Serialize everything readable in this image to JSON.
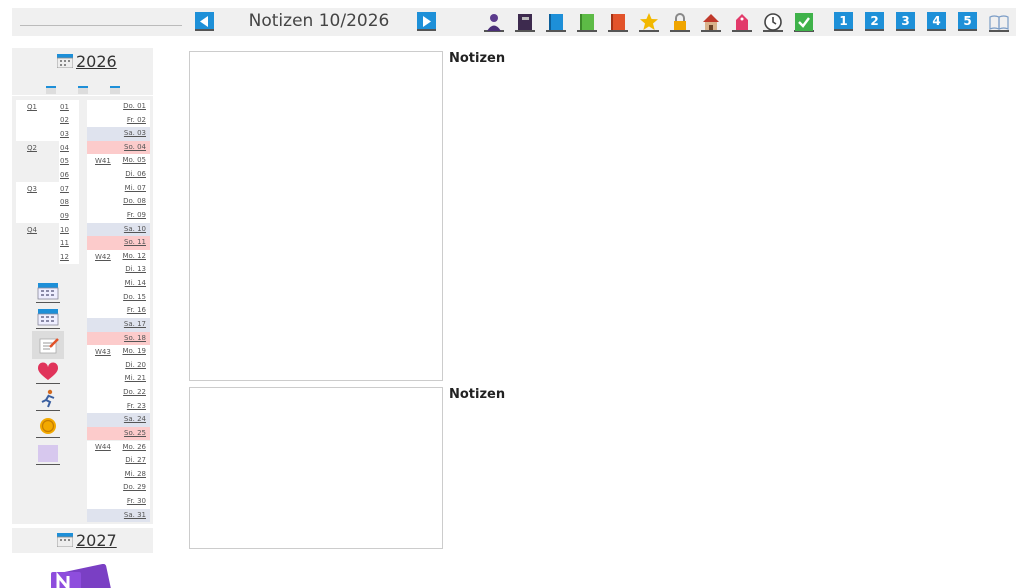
{
  "header": {
    "title": "Notizen 10/2026"
  },
  "toolbar": {
    "icons": [
      "person-icon",
      "address-book-icon",
      "blue-book-icon",
      "green-book-icon",
      "red-book-icon",
      "star-icon",
      "lock-icon",
      "house-icon",
      "tag-icon",
      "clock-icon",
      "checkbox-icon"
    ],
    "numbers": [
      "1",
      "2",
      "3",
      "4",
      "5"
    ]
  },
  "sidebar": {
    "year": "2026",
    "next_year": "2027",
    "quarters": [
      "Q1",
      "Q2",
      "Q3",
      "Q4"
    ],
    "months": [
      "01",
      "02",
      "03",
      "04",
      "05",
      "06",
      "07",
      "08",
      "09",
      "10",
      "11",
      "12"
    ],
    "weeks": [
      "W41",
      "W42",
      "W43",
      "W44"
    ],
    "days": [
      "Do. 01",
      "Fr. 02",
      "Sa. 03",
      "So. 04",
      "Mo. 05",
      "Di. 06",
      "Mi. 07",
      "Do. 08",
      "Fr. 09",
      "Sa. 10",
      "So. 11",
      "Mo. 12",
      "Di. 13",
      "Mi. 14",
      "Do. 15",
      "Fr. 16",
      "Sa. 17",
      "So. 18",
      "Mo. 19",
      "Di. 20",
      "Mi. 21",
      "Do. 22",
      "Fr. 23",
      "Sa. 24",
      "So. 25",
      "Mo. 26",
      "Di. 27",
      "Mi. 28",
      "Do. 29",
      "Fr. 30",
      "Sa. 31"
    ],
    "day_types": [
      "",
      "",
      "sa",
      "so",
      "",
      "",
      "",
      "",
      "",
      "sa",
      "so",
      "",
      "",
      "",
      "",
      "",
      "sa",
      "so",
      "",
      "",
      "",
      "",
      "",
      "sa",
      "so",
      "",
      "",
      "",
      "",
      "",
      "sa"
    ],
    "side_icons": [
      "calendar-icon",
      "calendar-icon",
      "notes-icon",
      "heart-icon",
      "runner-icon",
      "coin-icon",
      "purple-page-icon"
    ]
  },
  "notes": {
    "label_1": "Notizen",
    "label_2": "Notizen"
  },
  "colors": {
    "accent": "#1e90d8",
    "saturday": "#dfe3ee",
    "sunday": "#fccbcb",
    "panel": "#f0f0f0"
  }
}
